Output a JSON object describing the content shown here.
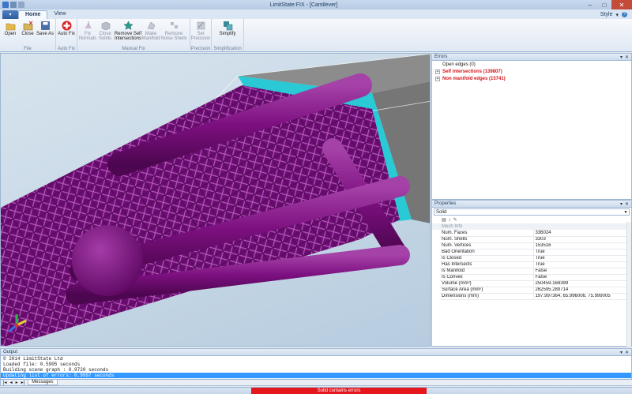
{
  "window": {
    "title": "LimitState:FIX - [Cantilever]"
  },
  "tabs": [
    {
      "label": "Home"
    },
    {
      "label": "View"
    }
  ],
  "tabs_right": {
    "style": "Style"
  },
  "ribbon": {
    "groups": [
      {
        "label": "File",
        "buttons": [
          {
            "label": "Open"
          },
          {
            "label": "Close"
          },
          {
            "label": "Save As"
          }
        ]
      },
      {
        "label": "Auto Fix",
        "buttons": [
          {
            "label": "Auto Fix"
          }
        ]
      },
      {
        "label": "Manual Fix",
        "buttons": [
          {
            "label": "Fix Normals"
          },
          {
            "label": "Close Solids"
          },
          {
            "label": "Remove Self Intersections"
          },
          {
            "label": "Make Manifold"
          },
          {
            "label": "Remove Noise Shells"
          }
        ]
      },
      {
        "label": "Precision",
        "buttons": [
          {
            "label": "Set Precision"
          }
        ]
      },
      {
        "label": "Simplification",
        "buttons": [
          {
            "label": "Simplify"
          }
        ]
      }
    ]
  },
  "errors_panel": {
    "title": "Errors",
    "items": [
      {
        "label": "Open edges (0)",
        "error": false
      },
      {
        "label": "Self intersections (139807)",
        "error": true
      },
      {
        "label": "Non manifold edges (15741)",
        "error": true
      }
    ]
  },
  "properties_panel": {
    "title": "Properties",
    "selected": "Solid",
    "category": "Mesh Info",
    "rows": [
      {
        "key": "Num. Faces",
        "value": "336024"
      },
      {
        "key": "Num. Shells",
        "value": "3303"
      },
      {
        "key": "Num. Vertices",
        "value": "153516"
      },
      {
        "key": "Bad Orientation",
        "value": "True"
      },
      {
        "key": "Is Closed",
        "value": "True"
      },
      {
        "key": "Has Intersects",
        "value": "True"
      },
      {
        "key": "Is Manifold",
        "value": "False"
      },
      {
        "key": "Is Convex",
        "value": "False"
      },
      {
        "key": "Volume (mm³)",
        "value": "250459.168399"
      },
      {
        "key": "Surface Area (mm²)",
        "value": "262595.289714"
      },
      {
        "key": "Dimensions (mm)",
        "value": "197.997364, 65.996006, 75.999005"
      }
    ]
  },
  "output_panel": {
    "title": "Output",
    "lines": [
      "© 2014 LimitState Ltd",
      "Loaded file: 0.5905 seconds",
      "Building scene graph : 0.9720 seconds",
      "Updating list of errors: 0.9997 seconds"
    ],
    "tab": "Messages"
  },
  "status": {
    "error_text": "Solid contains errors"
  },
  "colors": {
    "model": "#7d1080",
    "model_highlight": "#9a2a9e",
    "bbox_face": "#29c9d6",
    "error_red": "#e4161e",
    "selection_blue": "#3399ff"
  }
}
